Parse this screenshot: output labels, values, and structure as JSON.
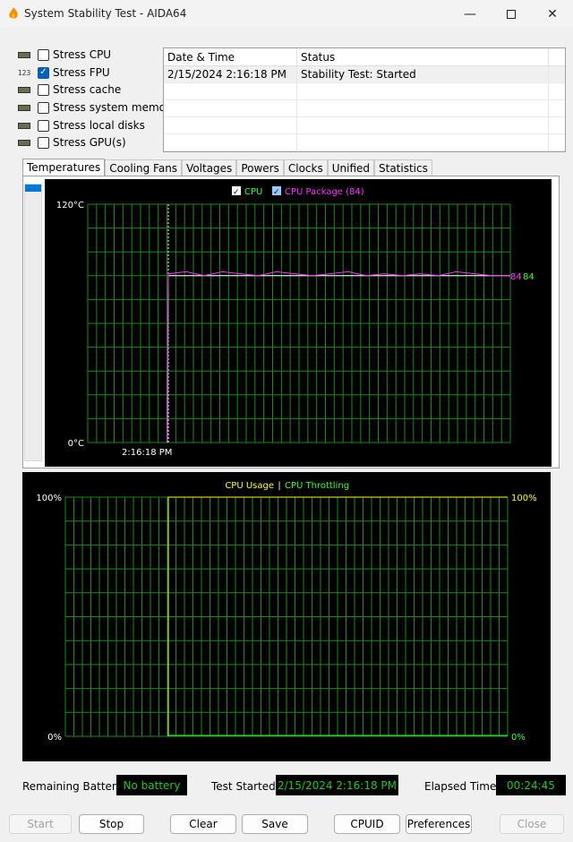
{
  "window": {
    "title": "System Stability Test - AIDA64"
  },
  "stress": [
    {
      "label": "Stress CPU",
      "checked": false,
      "icon": "cpu-chip-icon"
    },
    {
      "label": "Stress FPU",
      "checked": true,
      "icon": "fpu-123-icon",
      "icon_text": "123"
    },
    {
      "label": "Stress cache",
      "checked": false,
      "icon": "cache-chip-icon"
    },
    {
      "label": "Stress system memory",
      "checked": false,
      "icon": "memory-module-icon"
    },
    {
      "label": "Stress local disks",
      "checked": false,
      "icon": "disk-drive-icon"
    },
    {
      "label": "Stress GPU(s)",
      "checked": false,
      "icon": "gpu-monitor-icon"
    }
  ],
  "log": {
    "columns": [
      "Date & Time",
      "Status"
    ],
    "rows": [
      {
        "time": "2/15/2024 2:16:18 PM",
        "status": "Stability Test: Started"
      }
    ]
  },
  "tabs": [
    "Temperatures",
    "Cooling Fans",
    "Voltages",
    "Powers",
    "Clocks",
    "Unified",
    "Statistics"
  ],
  "temp_legend": {
    "cpu": "CPU",
    "package": "CPU Package (84)"
  },
  "usage_legend": {
    "usage": "CPU Usage",
    "sep": "|",
    "throttling": "CPU Throttling"
  },
  "status": {
    "battery_label": "Remaining Battery:",
    "battery_value": "No battery",
    "started_label": "Test Started:",
    "started_value": "2/15/2024 2:16:18 PM",
    "elapsed_label": "Elapsed Time:",
    "elapsed_value": "00:24:45"
  },
  "buttons": {
    "start": "Start",
    "stop": "Stop",
    "clear": "Clear",
    "save": "Save",
    "cpuid": "CPUID",
    "preferences": "Preferences",
    "close": "Close"
  },
  "colors": {
    "grid": "#1a8a1a",
    "cpu_line": "#ffffff",
    "package_line": "#ff32ff",
    "usage_line": "#ffff00",
    "throttle_text": "#32ff32",
    "value_text": "#1ec81e"
  },
  "chart_data": [
    {
      "type": "line",
      "title": "",
      "ylabel": "",
      "ylim": [
        0,
        120
      ],
      "y_tick_labels": [
        "120°C",
        "0°C"
      ],
      "x_tick_labels": [
        "2:16:18 PM"
      ],
      "current_value_labels": [
        "84",
        "84"
      ],
      "series": [
        {
          "name": "CPU",
          "values": [
            0,
            84,
            84,
            84,
            84,
            84,
            84,
            84,
            84,
            84,
            84,
            84,
            84,
            84,
            84,
            84,
            84,
            84,
            84,
            84,
            84
          ]
        },
        {
          "name": "CPU Package (84)",
          "values": [
            0,
            85,
            86,
            84,
            86,
            85,
            84,
            86,
            85,
            84,
            85,
            86,
            84,
            85,
            84,
            85,
            84,
            86,
            85,
            84,
            84
          ]
        }
      ]
    },
    {
      "type": "line",
      "title": "",
      "ylim": [
        0,
        100
      ],
      "y_tick_labels": [
        "100%",
        "0%"
      ],
      "y_tick_labels_right": [
        "100%",
        "0%"
      ],
      "series": [
        {
          "name": "CPU Usage",
          "values": [
            0,
            100,
            100,
            100,
            100,
            100,
            100,
            100,
            100,
            100
          ]
        },
        {
          "name": "CPU Throttling",
          "values": [
            0,
            0,
            0,
            0,
            0,
            0,
            0,
            0,
            0,
            0
          ]
        }
      ]
    }
  ]
}
